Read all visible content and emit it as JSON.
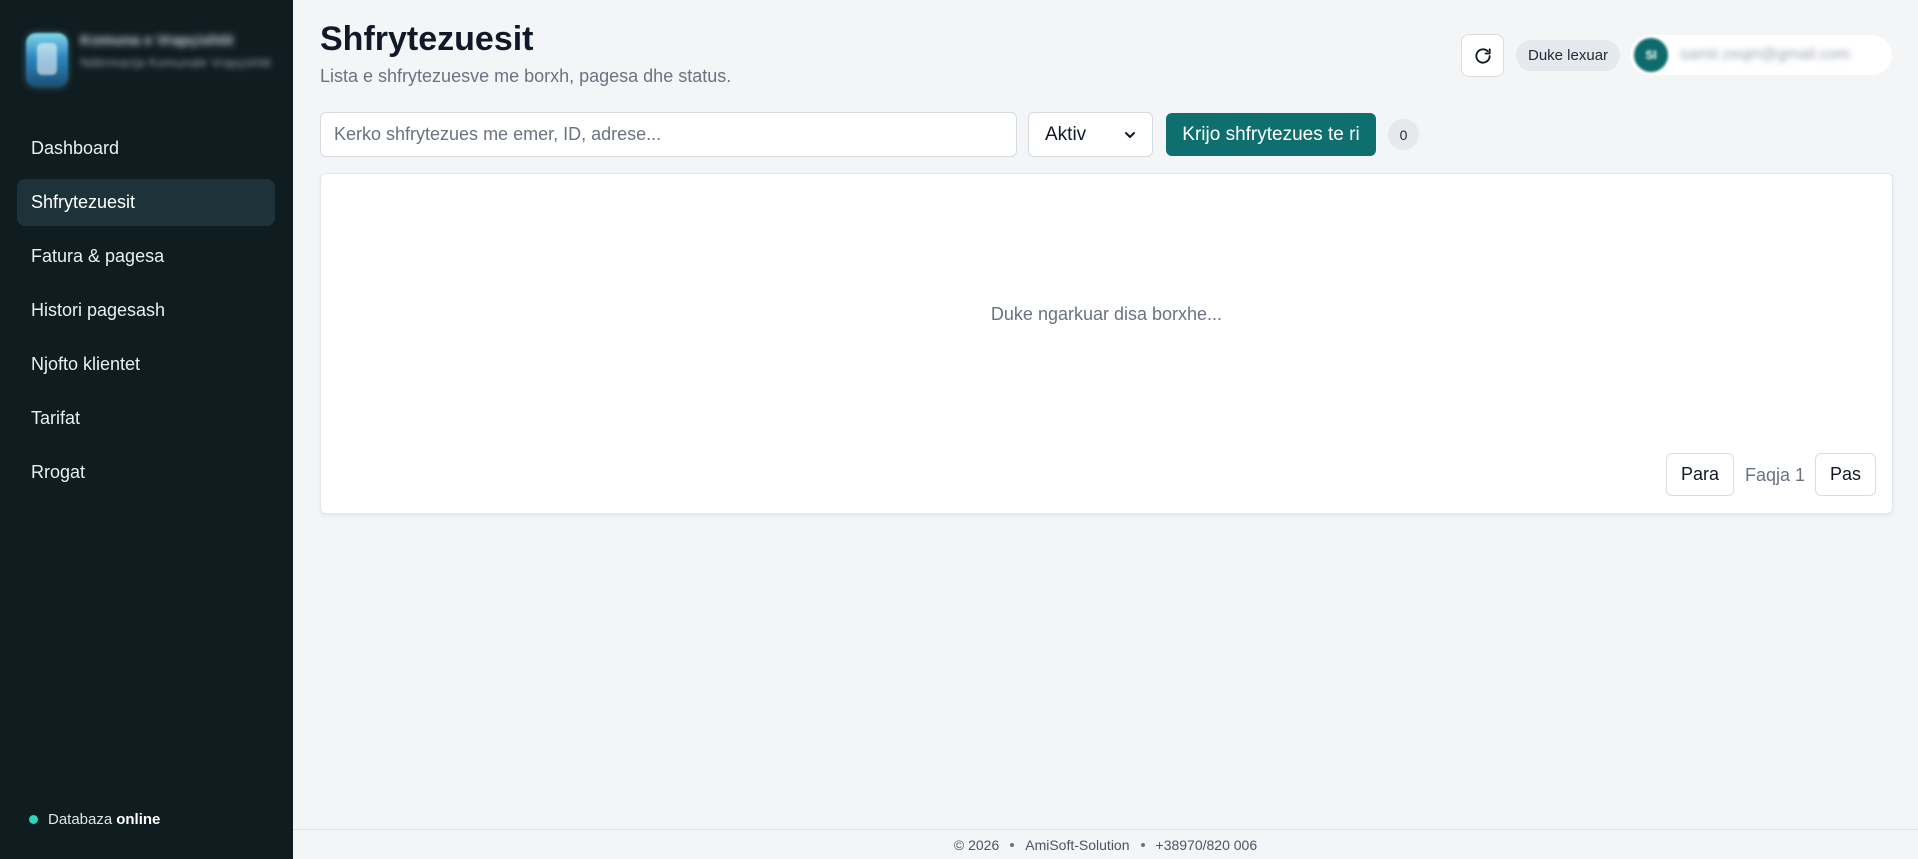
{
  "sidebar": {
    "brand": {
      "title": "Komuna e Vrapçishtit",
      "subtitle": "Ndërmarrja Komunale Vrapçishtit",
      "logo_icon": "brand-logo-icon"
    },
    "items": [
      {
        "label": "Dashboard"
      },
      {
        "label": "Shfrytezuesit",
        "active": true
      },
      {
        "label": "Fatura & pagesa"
      },
      {
        "label": "Histori pagesash"
      },
      {
        "label": "Njofto klientet"
      },
      {
        "label": "Tarifat"
      },
      {
        "label": "Rrogat"
      }
    ],
    "db_status": {
      "label": "Databaza",
      "value": "online",
      "dot_color": "#2dd4bf"
    }
  },
  "header": {
    "title": "Shfrytezuesit",
    "subtitle": "Lista e shfrytezuesve me borxh, pagesa dhe status.",
    "refresh_icon": "refresh-icon",
    "status_pill": "Duke lexuar",
    "user": {
      "initials": "SI",
      "email": "samir.zeqiri@gmail.com"
    }
  },
  "toolbar": {
    "search_placeholder": "Kerko shfrytezues me emer, ID, adrese...",
    "search_value": "",
    "status_filter": "Aktiv",
    "create_label": "Krijo shfrytezues te ri",
    "count": "0"
  },
  "main": {
    "loading_text": "Duke ngarkuar disa borxhe...",
    "pagination": {
      "prev_label": "Para",
      "page_label": "Faqja 1",
      "next_label": "Pas"
    }
  },
  "footer": {
    "copyright": "© 2026",
    "company": "AmiSoft-Solution",
    "phone": "+38970/820 006"
  },
  "colors": {
    "sidebar_bg": "#0f1c20",
    "accent": "#0f6e6e",
    "page_bg": "#f3f5f7"
  }
}
